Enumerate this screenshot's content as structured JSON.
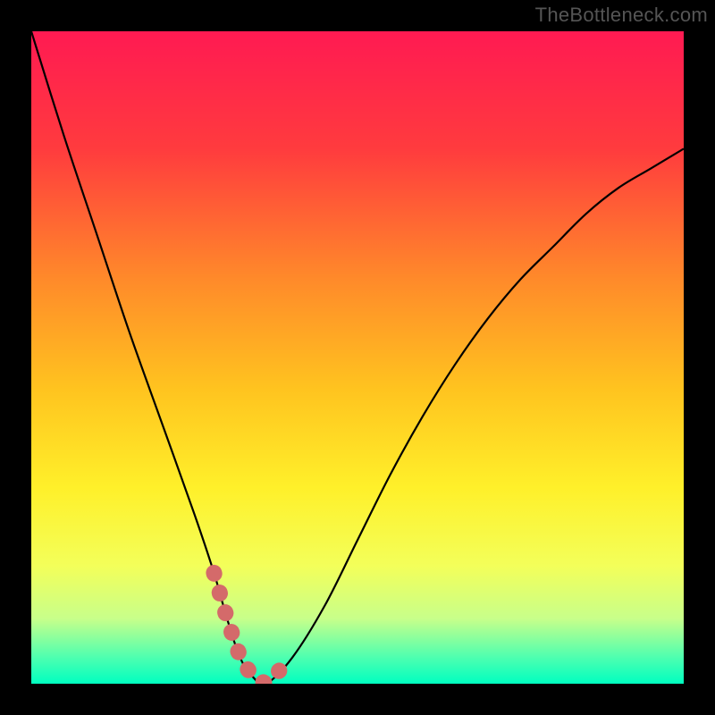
{
  "watermark": "TheBottleneck.com",
  "chart_data": {
    "type": "line",
    "title": "",
    "xlabel": "",
    "ylabel": "",
    "xlim": [
      0,
      100
    ],
    "ylim": [
      0,
      100
    ],
    "grid": false,
    "series": [
      {
        "name": "bottleneck-curve",
        "color": "#000000",
        "x": [
          0,
          5,
          10,
          15,
          20,
          25,
          28,
          30,
          32,
          34,
          36,
          40,
          45,
          50,
          55,
          60,
          65,
          70,
          75,
          80,
          85,
          90,
          95,
          100
        ],
        "y": [
          100,
          84,
          69,
          54,
          40,
          26,
          17,
          10,
          4,
          1,
          0,
          4,
          12,
          22,
          32,
          41,
          49,
          56,
          62,
          67,
          72,
          76,
          79,
          82
        ]
      }
    ],
    "highlight_band": {
      "name": "optimal-range",
      "color": "#d46a6a",
      "x_range": [
        28,
        38
      ],
      "y_at_range": [
        17,
        2
      ]
    },
    "background": {
      "type": "vertical-gradient",
      "stops": [
        {
          "offset": 0.0,
          "color": "#ff1a52"
        },
        {
          "offset": 0.18,
          "color": "#ff3b3e"
        },
        {
          "offset": 0.38,
          "color": "#ff8a2a"
        },
        {
          "offset": 0.55,
          "color": "#ffc41f"
        },
        {
          "offset": 0.7,
          "color": "#fff02a"
        },
        {
          "offset": 0.82,
          "color": "#f3ff5a"
        },
        {
          "offset": 0.9,
          "color": "#c8ff8a"
        },
        {
          "offset": 0.96,
          "color": "#4dffb0"
        },
        {
          "offset": 1.0,
          "color": "#00ffc0"
        }
      ]
    }
  }
}
